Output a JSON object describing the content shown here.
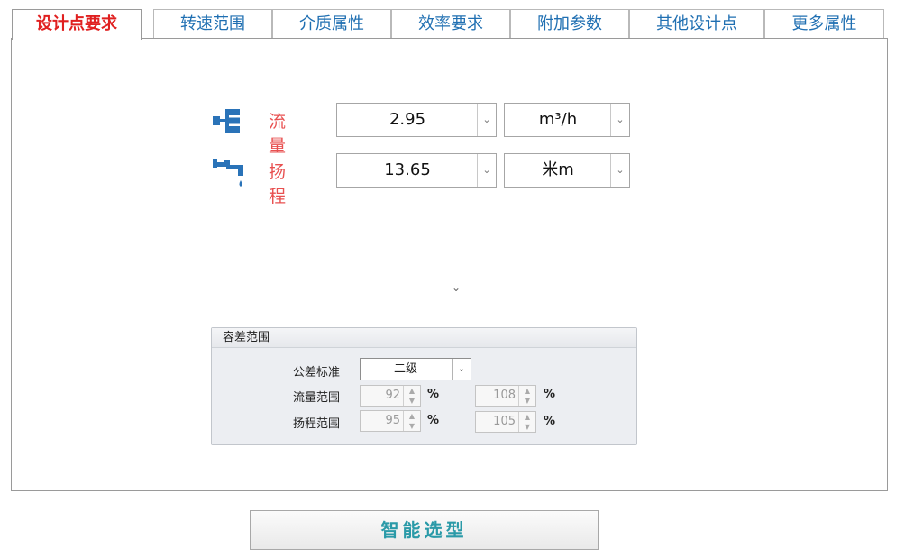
{
  "tabs": [
    {
      "label": "设计点要求",
      "active": true
    },
    {
      "label": "转速范围",
      "active": false
    },
    {
      "label": "介质属性",
      "active": false
    },
    {
      "label": "效率要求",
      "active": false
    },
    {
      "label": "附加参数",
      "active": false
    },
    {
      "label": "其他设计点",
      "active": false
    },
    {
      "label": "更多属性",
      "active": false
    }
  ],
  "design_point": {
    "flow": {
      "icon": "flow-icon",
      "label": "流量",
      "value": "2.95",
      "unit": "m³/h"
    },
    "head": {
      "icon": "head-icon",
      "label": "扬程",
      "value": "13.65",
      "unit": "米m"
    }
  },
  "tolerance": {
    "title": "容差范围",
    "standard_label": "公差标准",
    "standard_value": "二级",
    "flow_range_label": "流量范围",
    "flow_min": "92",
    "flow_max": "108",
    "head_range_label": "扬程范围",
    "head_min": "95",
    "head_max": "105",
    "percent": "%"
  },
  "actions": {
    "smart_select_label": "智能选型"
  },
  "colors": {
    "accent_blue": "#1f6fb2",
    "active_red": "#e02020",
    "label_red": "#e85050",
    "button_teal": "#2a9aa8"
  }
}
